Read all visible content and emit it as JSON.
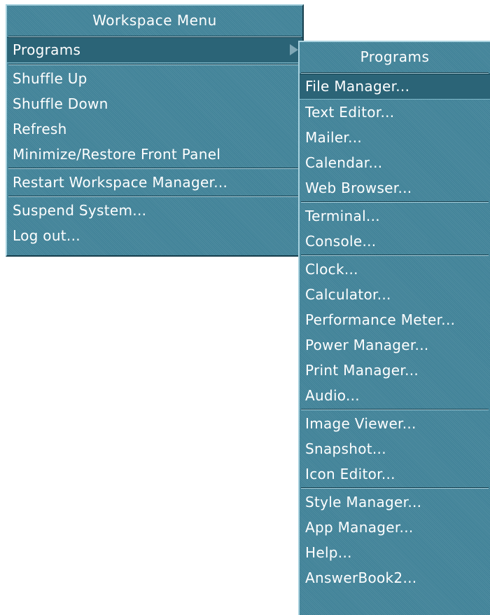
{
  "workspace_menu": {
    "title": "Workspace Menu",
    "groups": [
      [
        {
          "label": "Programs",
          "submenu": true
        }
      ],
      [
        {
          "label": "Shuffle Up"
        },
        {
          "label": "Shuffle Down"
        },
        {
          "label": "Refresh"
        },
        {
          "label": "Minimize/Restore Front Panel"
        }
      ],
      [
        {
          "label": "Restart Workspace Manager..."
        }
      ],
      [
        {
          "label": "Suspend System..."
        },
        {
          "label": "Log out..."
        }
      ]
    ]
  },
  "programs_menu": {
    "title": "Programs",
    "groups": [
      [
        {
          "label": "File Manager..."
        },
        {
          "label": "Text Editor..."
        },
        {
          "label": "Mailer..."
        },
        {
          "label": "Calendar..."
        },
        {
          "label": "Web Browser..."
        }
      ],
      [
        {
          "label": "Terminal..."
        },
        {
          "label": "Console..."
        }
      ],
      [
        {
          "label": "Clock..."
        },
        {
          "label": "Calculator..."
        },
        {
          "label": "Performance Meter..."
        },
        {
          "label": "Power Manager..."
        },
        {
          "label": "Print Manager..."
        },
        {
          "label": "Audio..."
        }
      ],
      [
        {
          "label": "Image Viewer..."
        },
        {
          "label": "Snapshot..."
        },
        {
          "label": "Icon Editor..."
        }
      ],
      [
        {
          "label": "Style Manager..."
        },
        {
          "label": "App Manager..."
        },
        {
          "label": "Help..."
        },
        {
          "label": "AnswerBook2..."
        }
      ]
    ]
  }
}
